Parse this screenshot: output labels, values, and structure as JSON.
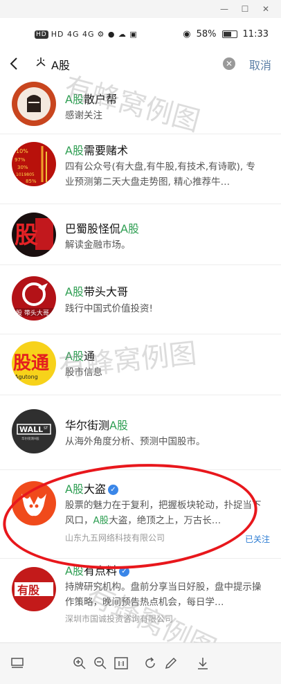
{
  "status": {
    "left": "HD 4G 4G",
    "battery": "58%",
    "time": "11:33"
  },
  "search": {
    "query": "A股",
    "cancel": "取消"
  },
  "results": [
    {
      "name_hl": "A股",
      "name_rest": "散户帮",
      "desc": "感谢关注"
    },
    {
      "name_hl": "A股",
      "name_rest": "需要赌术",
      "desc": "四有公众号(有大盘,有牛股,有技术,有诗歌), 专业预测第二天大盘走势图, 精心推荐牛…"
    },
    {
      "name_pre": "巴蜀股怪侃",
      "name_hl": "A股",
      "desc": "解读金融市场。"
    },
    {
      "name_hl": "A股",
      "name_rest": "带头大哥",
      "desc": "践行中国式价值投资!"
    },
    {
      "name_hl": "A股",
      "name_rest": "通",
      "desc": "股市信息"
    },
    {
      "name_pre": "华尔街测",
      "name_hl": "A股",
      "desc": "从海外角度分析、预测中国股市。"
    },
    {
      "name_hl": "A股",
      "name_rest": "大盗",
      "desc_a": "股票的魅力在于复利，把握板块轮动，扑捉当下风口，",
      "desc_hl": "A股",
      "desc_b": "大盗，绝顶之上，万古长…",
      "owner": "山东九五网络科技有限公司",
      "followed": "已关注"
    },
    {
      "name_hl": "A股",
      "name_rest": "有点料",
      "desc": "持牌研究机构。盘前分享当日好股，盘中提示操作策略，晚间预告热点机会，每日学…",
      "owner": "深圳市国诚投资咨询有限公司"
    }
  ],
  "avatars": {
    "r2": [
      "10%",
      "97%",
      "30%",
      "1019805",
      "85%"
    ],
    "r3": "股",
    "r4": "股 带头大哥",
    "r5_main": "股通",
    "r5_sub": "Agutong",
    "r6_main": "WALL",
    "r6_st": "ST",
    "r6_sub": "华尔街测A股",
    "r8": "有股"
  },
  "watermark": "有蜂窝例图",
  "colors": {
    "highlight": "#2e9e52",
    "link": "#5b7fa6",
    "annotation": "#e8171c"
  }
}
